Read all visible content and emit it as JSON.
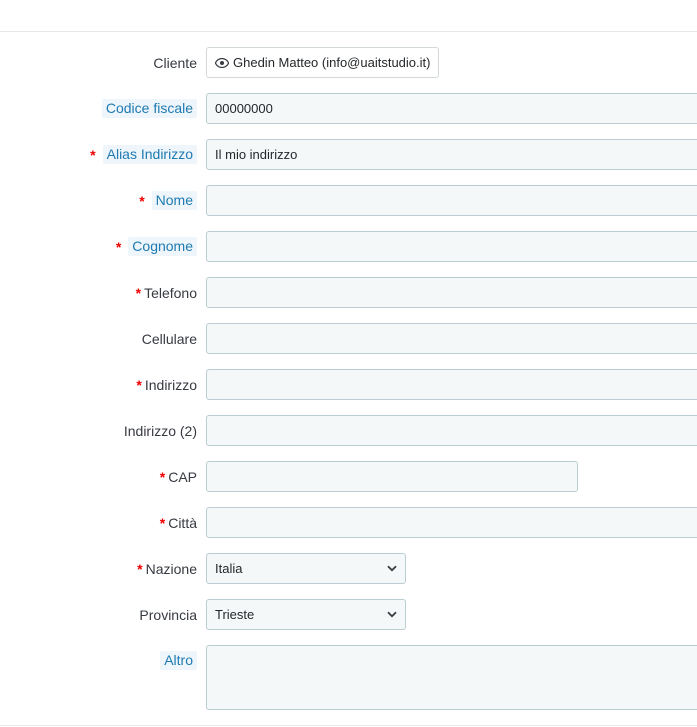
{
  "form": {
    "cliente": {
      "label": "Cliente",
      "value": "Ghedin Matteo (info@uaitstudio.it)"
    },
    "codice_fiscale": {
      "label": "Codice fiscale",
      "value": "00000000"
    },
    "alias": {
      "label": "Alias Indirizzo",
      "value": "Il mio indirizzo"
    },
    "nome": {
      "label": "Nome",
      "value": ""
    },
    "cognome": {
      "label": "Cognome",
      "value": ""
    },
    "telefono": {
      "label": "Telefono",
      "value": ""
    },
    "cellulare": {
      "label": "Cellulare",
      "value": ""
    },
    "indirizzo": {
      "label": "Indirizzo",
      "value": ""
    },
    "indirizzo2": {
      "label": "Indirizzo (2)",
      "value": ""
    },
    "cap": {
      "label": "CAP",
      "value": ""
    },
    "citta": {
      "label": "Città",
      "value": ""
    },
    "nazione": {
      "label": "Nazione",
      "value": "Italia"
    },
    "provincia": {
      "label": "Provincia",
      "value": "Trieste"
    },
    "altro": {
      "label": "Altro",
      "value": ""
    },
    "required_marker": "*"
  },
  "icons": {
    "client": "eye-icon",
    "select": "chevron-down-icon"
  },
  "colors": {
    "required": "#e00000",
    "help_label_text": "#1e7ab2",
    "help_label_bg": "#eef6fb",
    "field_bg": "#f5f8f9",
    "field_border": "#bbcdd2"
  }
}
